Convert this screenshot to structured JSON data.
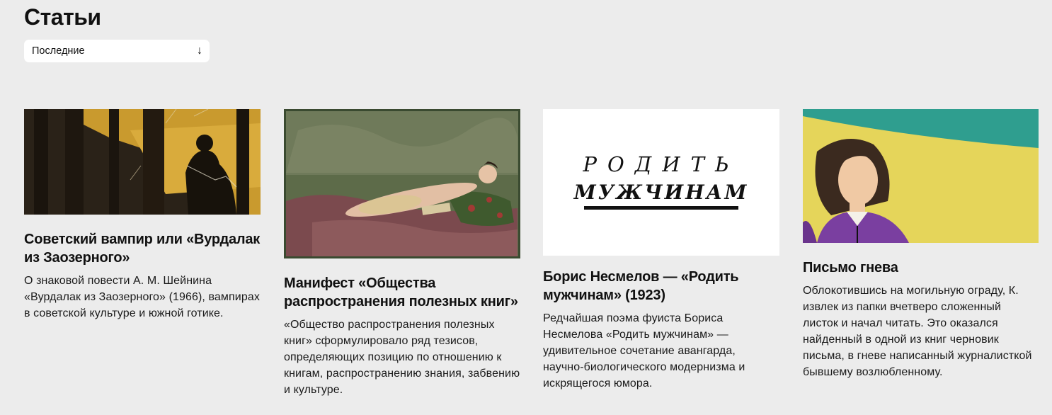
{
  "header": {
    "title": "Статьи",
    "sort": {
      "selected": "Последние",
      "icon": "arrow-down-icon"
    }
  },
  "articles": [
    {
      "title": "Советский вампир или «Вурдалак из Заозерного»",
      "description": "О знаковой повести А. М. Шейнина «Вурдалак из Заозерного» (1966), вампирах в советской культуре и южной готике."
    },
    {
      "title": "Манифест «Общества распространения полезных книг»",
      "description": "«Общество распространения полезных книг» сформулировало ряд тезисов, определяющих позицию по отношению к книгам, распространению знания, забвению и культуре."
    },
    {
      "title": "Борис Несмелов — «Родить мужчинам» (1923)",
      "description": "Редчайшая поэма фуиста Бориса Несмелова «Родить мужчинам» — удивительное сочетание авангарда, научно-биологического модернизма и искрящегося юмора.",
      "cover_text": [
        "РОДИТЬ",
        "МУЖЧИНАМ"
      ]
    },
    {
      "title": "Письмо гнева",
      "description": "Облокотившись на могильную ограду, К. извлек из папки вчетверо сложенный листок и начал читать. Это оказался найденный в одной из книг черновик письма, в гневе написанный журналисткой бывшему возлюбленному."
    }
  ]
}
